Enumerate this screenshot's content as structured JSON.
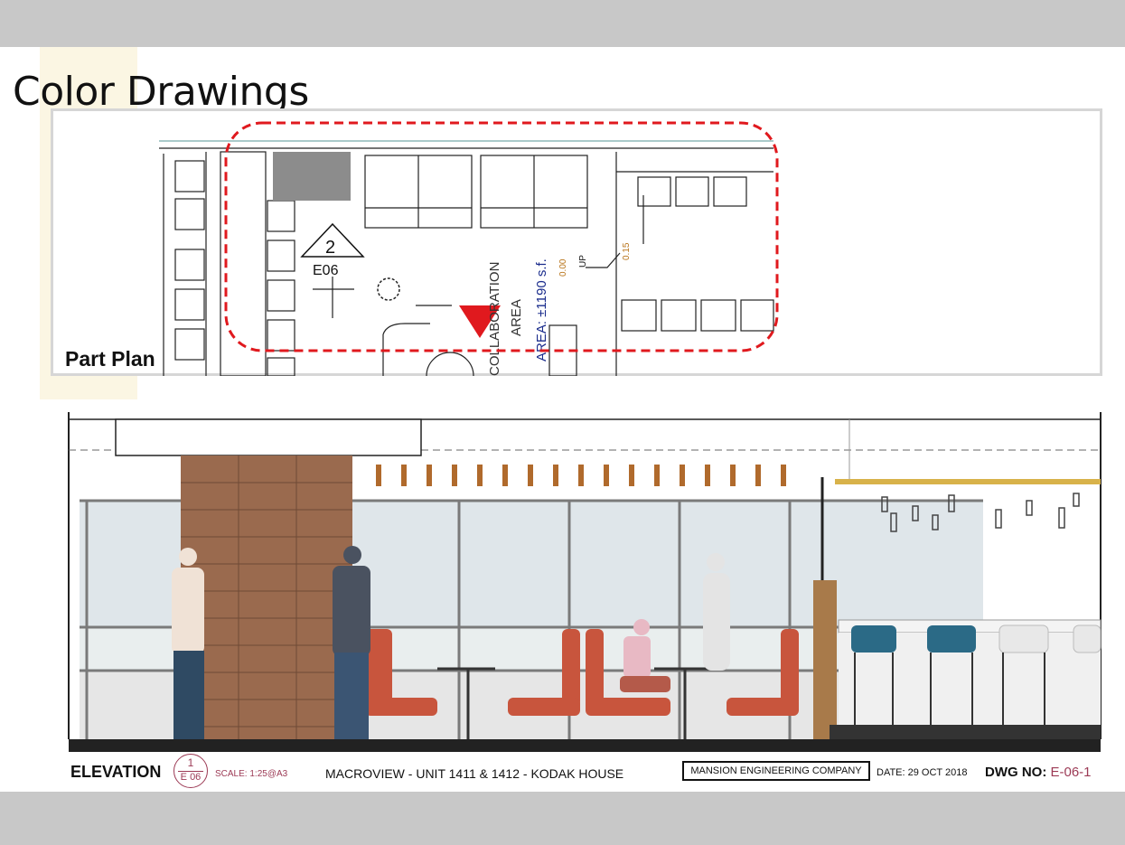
{
  "slide": {
    "title": "Color Drawings"
  },
  "part_plan": {
    "label": "Part Plan",
    "section_marker": {
      "number": "2",
      "sheet": "E06"
    },
    "room_name_line1": "COLLABORATION",
    "room_name_line2": "AREA",
    "area_text": "AREA: ±1190 s.f.",
    "level_1": "0.00",
    "level_2": "0.15",
    "up_label": "UP",
    "colors": {
      "highlight": "#e0191e",
      "area_text": "#1a2c8c",
      "level_text": "#b8741a"
    }
  },
  "elevation_title_block": {
    "label": "ELEVATION",
    "tag_number": "1",
    "tag_sheet": "E 06",
    "scale": "SCALE: 1:25@A3",
    "project": "MACROVIEW -  UNIT 1411 & 1412  - KODAK HOUSE",
    "company": "MANSION ENGINEERING COMPANY",
    "date": "DATE: 29 OCT 2018",
    "drawing_label": "DWG NO:",
    "drawing_number": "E-06-1",
    "colors": {
      "accent": "#9c3a55",
      "brick": "#9a6a4e",
      "booth": "#c8553d",
      "stool": "#2b6a86"
    }
  }
}
